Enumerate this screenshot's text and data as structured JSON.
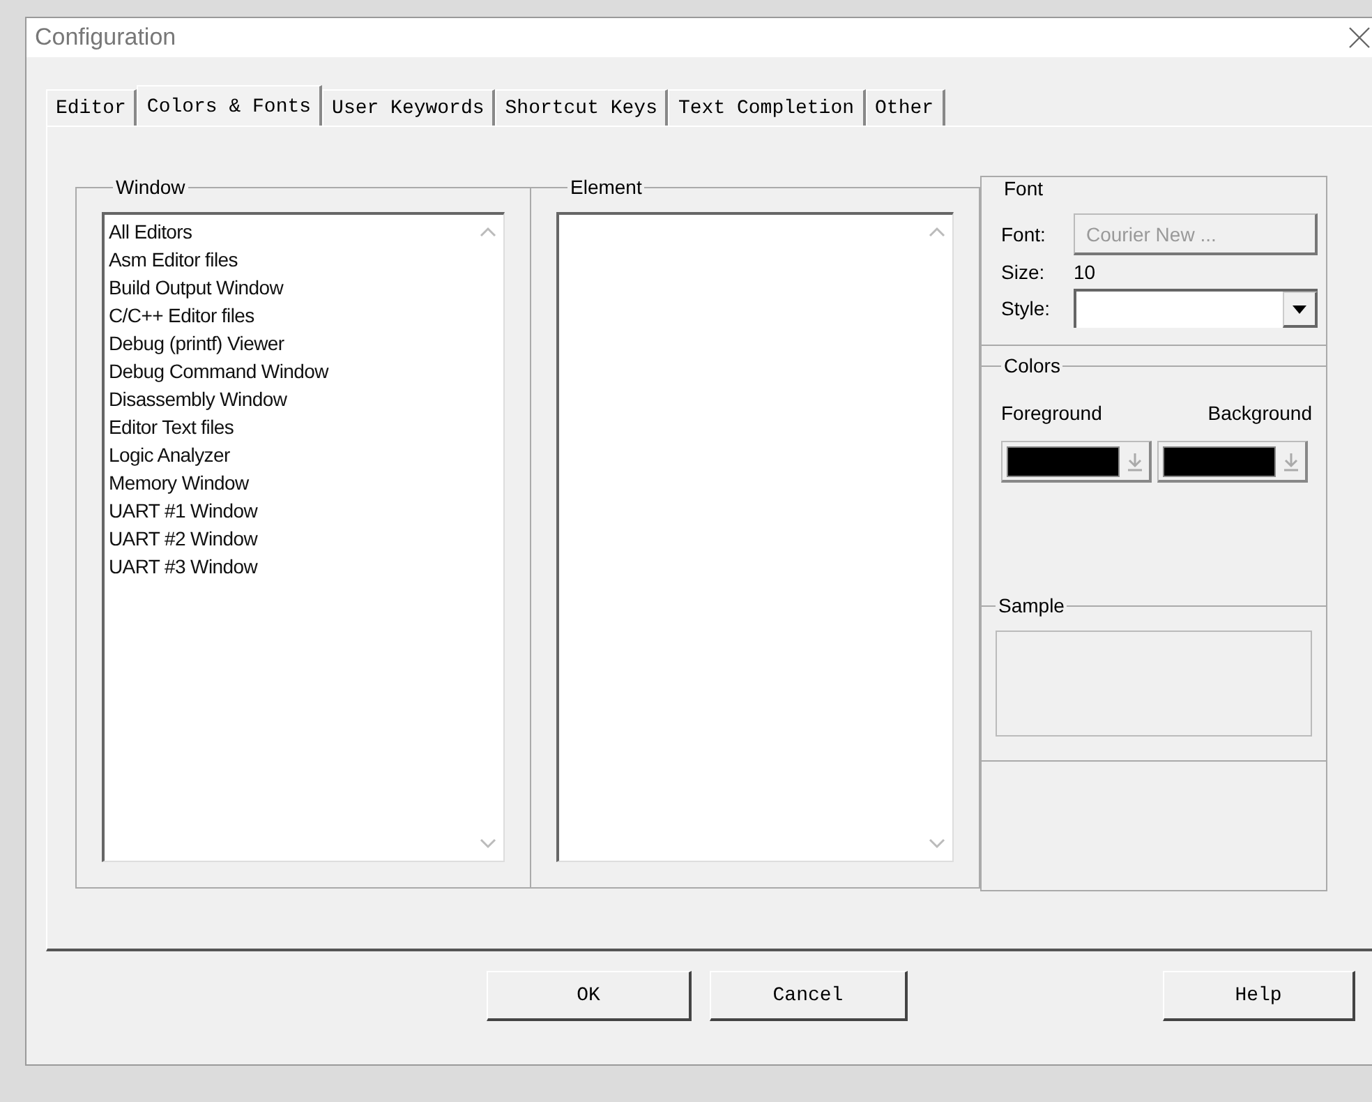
{
  "window": {
    "title": "Configuration"
  },
  "tabs": [
    {
      "label": "Editor",
      "selected": false
    },
    {
      "label": "Colors & Fonts",
      "selected": true
    },
    {
      "label": "User Keywords",
      "selected": false
    },
    {
      "label": "Shortcut Keys",
      "selected": false
    },
    {
      "label": "Text Completion",
      "selected": false
    },
    {
      "label": "Other",
      "selected": false
    }
  ],
  "window_group": {
    "label": "Window",
    "items": [
      {
        "label": "All Editors",
        "selected": false
      },
      {
        "label": "Asm Editor files",
        "selected": false
      },
      {
        "label": "Build Output Window",
        "selected": false
      },
      {
        "label": "C/C++ Editor files",
        "selected": false
      },
      {
        "label": "Debug (printf) Viewer",
        "selected": false
      },
      {
        "label": "Debug Command Window",
        "selected": false
      },
      {
        "label": "Disassembly Window",
        "selected": false
      },
      {
        "label": "Editor Text files",
        "selected": false
      },
      {
        "label": "Logic Analyzer",
        "selected": false
      },
      {
        "label": "Memory Window",
        "selected": false
      },
      {
        "label": "UART #1 Window",
        "selected": false
      },
      {
        "label": "UART #2 Window",
        "selected": false
      },
      {
        "label": "UART #3 Window",
        "selected": false
      }
    ]
  },
  "element_group": {
    "label": "Element"
  },
  "font_group": {
    "label": "Font",
    "font_label": "Font:",
    "font_button": {
      "label": "Courier New ...",
      "disabled": true
    },
    "size_label": "Size:",
    "size_value": "10",
    "style_label": "Style:"
  },
  "colors_group": {
    "label": "Colors",
    "pickers": [
      {
        "label": "Foreground",
        "color": "#000000"
      },
      {
        "label": "Background",
        "color": "#000000"
      }
    ]
  },
  "sample_group": {
    "label": "Sample"
  },
  "buttons": [
    {
      "label": "OK"
    },
    {
      "label": "Cancel"
    },
    {
      "label": "Help"
    }
  ]
}
